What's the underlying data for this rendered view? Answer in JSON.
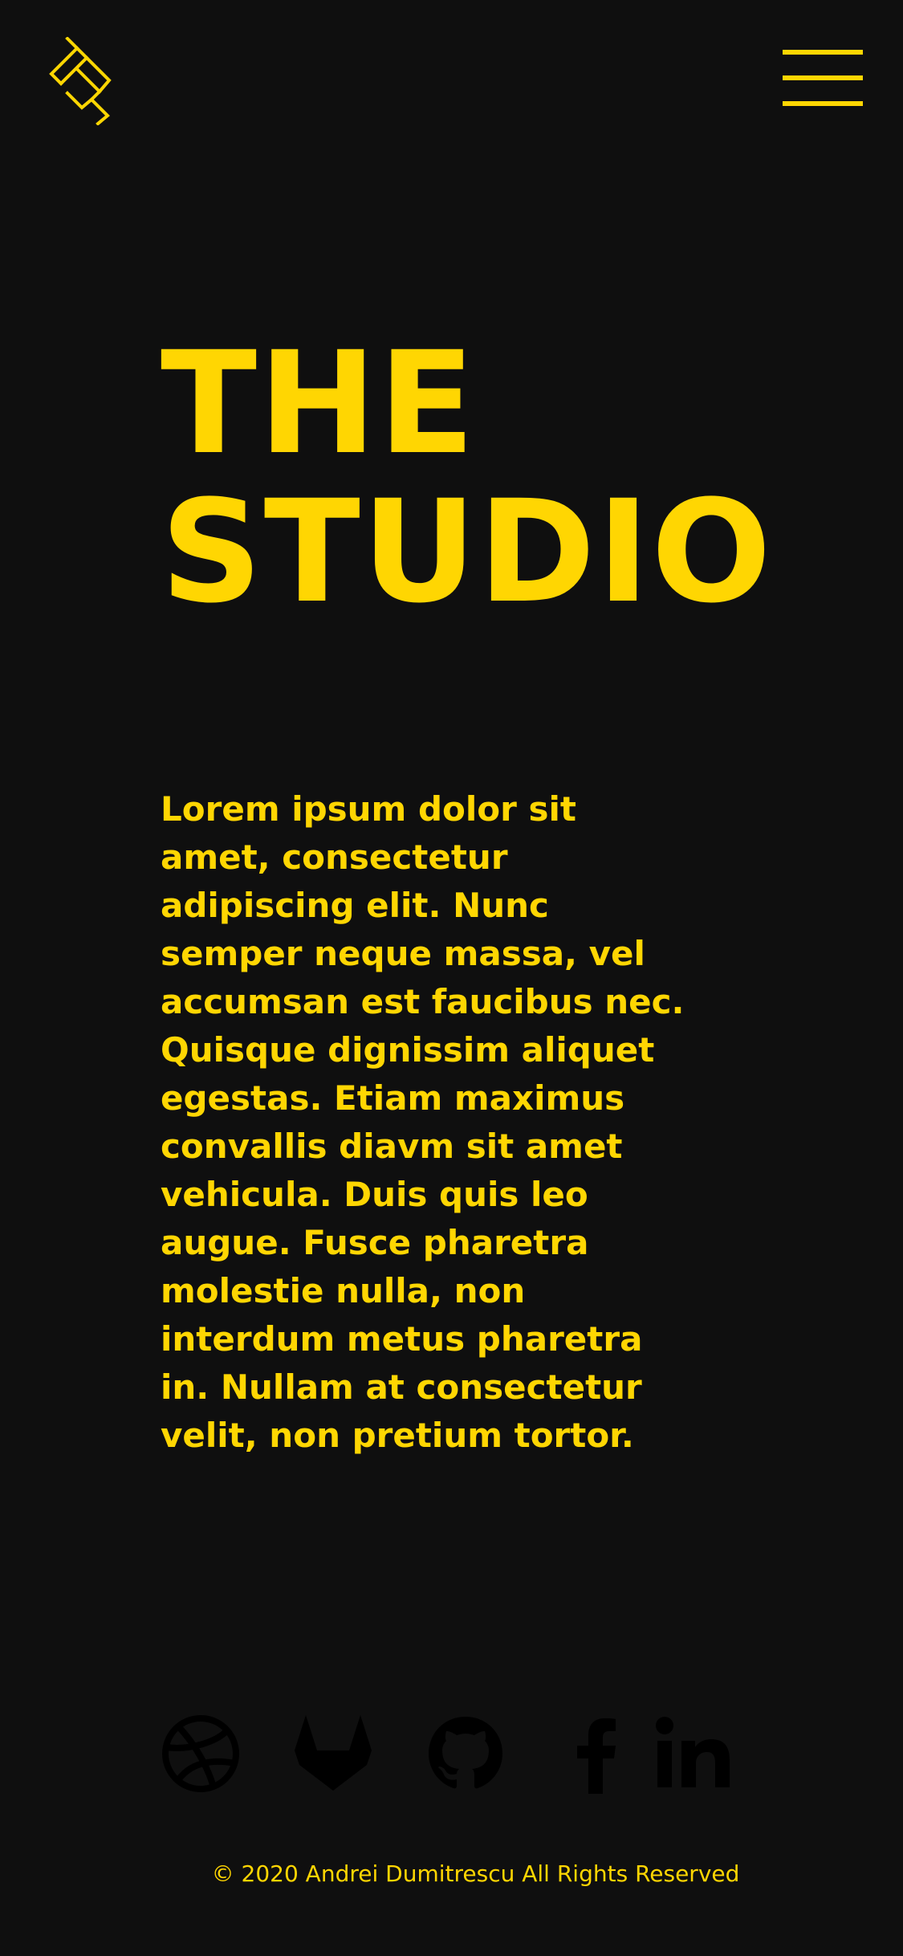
{
  "colors": {
    "background": "#0f0f0f",
    "accent": "#ffd602",
    "social_icon": "#000000"
  },
  "header": {
    "logo_icon": "geometric-studio-logo-icon",
    "menu_icon": "hamburger-menu-icon"
  },
  "hero": {
    "title_line_1": "THE",
    "title_line_2": "STUDIO"
  },
  "intro": {
    "lines": [
      "Lorem ipsum dolor sit",
      "amet, consectetur",
      "adipiscing elit. Nunc",
      "semper neque massa, vel",
      "accumsan est faucibus nec.",
      "Quisque dignissim aliquet",
      "egestas. Etiam maximus",
      "convallis diavm sit amet",
      "vehicula. Duis quis leo",
      "augue. Fusce pharetra",
      "molestie nulla, non",
      "interdum metus pharetra",
      "in. Nullam at consectetur",
      "velit, non pretium tortor."
    ]
  },
  "social": {
    "icons": [
      "dribbble-icon",
      "gitlab-icon",
      "github-icon",
      "facebook-icon",
      "linkedin-icon"
    ]
  },
  "footer": {
    "copyright": "© 2020 Andrei Dumitrescu All Rights Reserved"
  }
}
